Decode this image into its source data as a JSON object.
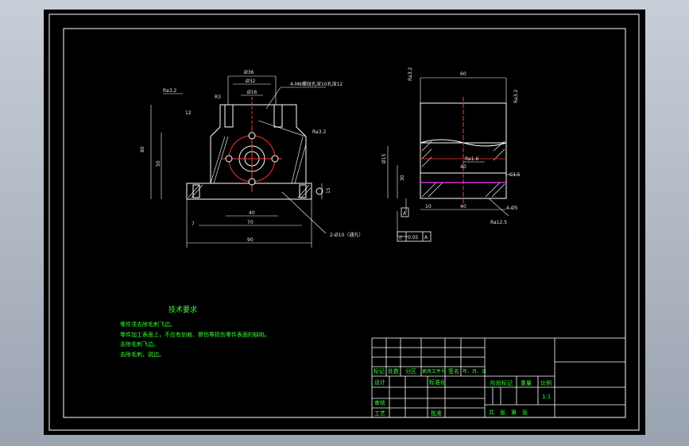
{
  "drawing": {
    "tech_title": "技术要求",
    "tech_notes": [
      "零件须去除毛刺飞边。",
      "零件加工表面上，不应有划痕、擦伤等损伤零件表面的缺陷。",
      "去除毛刺飞边。",
      "去除毛刺，锐边。"
    ],
    "front_view": {
      "dims": {
        "d1": "Ø36",
        "d2": "Ø32",
        "d3": "Ø16",
        "thread": "4-M6螺纹孔深10孔深12",
        "ra_left": "Ra3.2",
        "ra_right": "Ra3.2",
        "h_total": "80",
        "h_mid": "50",
        "h_base": "15",
        "w_inner": "40",
        "w_mid": "70",
        "w_total": "90",
        "left_offset": "7",
        "small_r": "R3",
        "hole_note": "2-Ø10（通孔）",
        "slot": "12"
      }
    },
    "side_view": {
      "dims": {
        "top_width": "60",
        "ra_top_left": "Ra3.2",
        "ra_top_right": "Ra3.2",
        "h_left": "Ø15",
        "h_mid": "30",
        "base_left": "10",
        "base_mid": "40",
        "ra_mid": "Ra1.6",
        "chamfer": "C1.5",
        "ra_bottom": "Ra12.5",
        "bolt": "4-Ø5",
        "datum": "A",
        "inner_w": "40"
      },
      "tolerance": {
        "symbol": "//",
        "value": "0.05",
        "datum": "A"
      }
    },
    "title_block": {
      "row_labels": [
        "标记",
        "处数",
        "分区",
        "更改文件号",
        "签名",
        "年、月、日"
      ],
      "design": "设计",
      "standard": "标准化",
      "check": "审核",
      "process": "工艺",
      "approve": "批准",
      "stage": "阶段标记",
      "weight": "重量",
      "scale_label": "比例",
      "scale": "1:1",
      "sheets": "共　张　第　张"
    }
  },
  "colors": {
    "line": "#ffffff",
    "text": "#33ff33",
    "accent": "#ff3333",
    "magenta": "#ff33ff"
  }
}
